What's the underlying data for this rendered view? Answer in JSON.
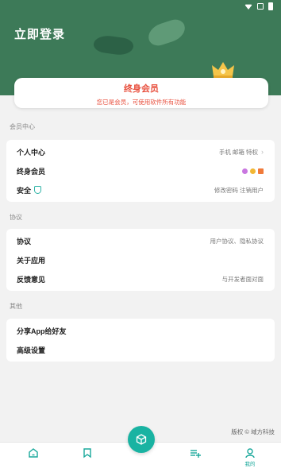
{
  "header": {
    "login_label": "立即登录",
    "accent": "#3d7a58"
  },
  "vip": {
    "title": "终身会员",
    "subtitle": "您已是会员，可使用软件所有功能",
    "color": "#e84f3d"
  },
  "sections": {
    "member_center": "会员中心",
    "agreement": "协议",
    "other": "其他"
  },
  "member_rows": {
    "personal": {
      "label": "个人中心",
      "right": "手机 邮箱 特权"
    },
    "lifetime": {
      "label": "终身会员"
    },
    "security": {
      "label": "安全",
      "right": "修改密码  注销用户"
    }
  },
  "agreement_rows": {
    "agreement": {
      "label": "协议",
      "right": "用户协议、隐私协议"
    },
    "about": {
      "label": "关于应用"
    },
    "feedback": {
      "label": "反馈意见",
      "right": "与开发者面对面"
    }
  },
  "other_rows": {
    "share": {
      "label": "分享App给好友"
    },
    "advanced": {
      "label": "高级设置"
    }
  },
  "footer": {
    "copyright": "版权 © 域方科技"
  },
  "tabbar": {
    "mine_label": "我的",
    "active_color": "#19a89b"
  }
}
